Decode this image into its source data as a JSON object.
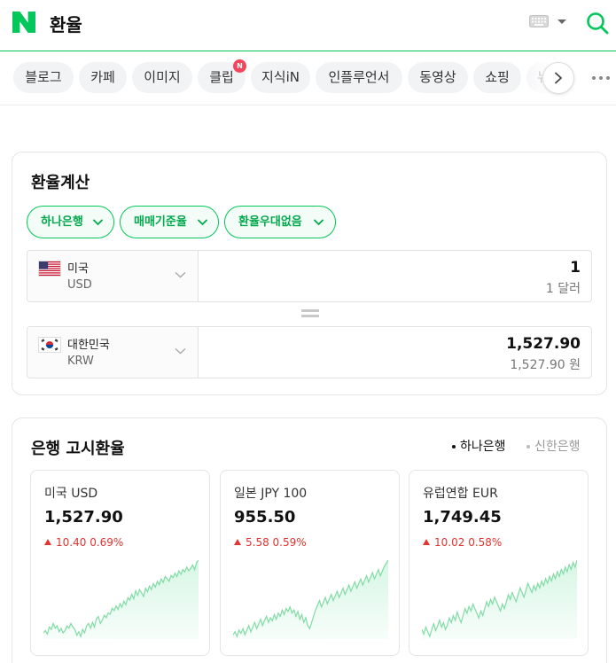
{
  "header": {
    "query": "환율",
    "brand_color": "#03c75a"
  },
  "tabs": [
    {
      "label": "블로그"
    },
    {
      "label": "카페"
    },
    {
      "label": "이미지"
    },
    {
      "label": "클립",
      "badge": "N"
    },
    {
      "label": "지식iN"
    },
    {
      "label": "인플루언서"
    },
    {
      "label": "동영상"
    },
    {
      "label": "쇼핑"
    },
    {
      "label": "뉴"
    }
  ],
  "icons": {
    "logo": "naver-n-logo",
    "keyboard": "keyboard-icon",
    "search": "search-icon",
    "next": "chevron-right-icon",
    "more": "more-dots-icon"
  },
  "calculator": {
    "title": "환율계산",
    "filters": [
      {
        "label": "하나은행"
      },
      {
        "label": "매매기준율"
      },
      {
        "label": "환율우대없음"
      }
    ],
    "from": {
      "country": "미국",
      "code": "USD",
      "amount": "1",
      "amount_text": "1 달러"
    },
    "to": {
      "country": "대한민국",
      "code": "KRW",
      "amount": "1,527.90",
      "amount_text": "1,527.90 원"
    }
  },
  "bank_rates": {
    "title": "은행 고시환율",
    "banks": [
      {
        "label": "하나은행",
        "selected": true
      },
      {
        "label": "신한은행",
        "selected": false
      }
    ],
    "up_color": "#e3342f",
    "items": [
      {
        "name": "미국 USD",
        "value": "1,527.90",
        "change": "10.40",
        "change_pct": "0.69%",
        "trend": [
          58,
          60,
          57,
          63,
          61,
          66,
          62,
          64,
          59,
          62,
          58,
          60,
          64,
          62,
          66,
          63,
          61,
          56,
          59,
          55,
          61,
          58,
          64,
          66,
          62,
          67,
          63,
          70,
          72,
          66,
          69,
          73,
          71,
          75,
          74,
          79,
          77,
          81,
          78,
          83,
          80,
          85,
          82,
          88,
          86,
          91,
          87,
          94,
          90,
          95,
          92,
          89,
          96,
          93,
          98,
          95,
          100,
          97,
          102,
          99,
          104,
          101,
          106,
          104,
          102,
          107,
          105,
          109,
          106,
          111,
          108,
          112,
          110,
          114,
          111,
          113,
          116,
          112,
          118,
          120
        ]
      },
      {
        "name": "일본 JPY 100",
        "value": "955.50",
        "change": "5.58",
        "change_pct": "0.59%",
        "trend": [
          64,
          66,
          63,
          67,
          65,
          68,
          64,
          67,
          70,
          66,
          69,
          72,
          68,
          71,
          74,
          70,
          73,
          76,
          72,
          75,
          73,
          77,
          74,
          78,
          76,
          80,
          77,
          81,
          79,
          82,
          78,
          80,
          76,
          79,
          74,
          77,
          72,
          75,
          70,
          68,
          72,
          76,
          80,
          83,
          86,
          82,
          85,
          88,
          84,
          87,
          90,
          86,
          89,
          92,
          88,
          91,
          94,
          90,
          93,
          96,
          92,
          95,
          98,
          94,
          97,
          100,
          96,
          99,
          102,
          98,
          101,
          104,
          100,
          103,
          106,
          102,
          105,
          108,
          110,
          112
        ]
      },
      {
        "name": "유럽연합 EUR",
        "value": "1,749.45",
        "change": "10.02",
        "change_pct": "0.58%",
        "trend": [
          70,
          66,
          72,
          68,
          64,
          70,
          75,
          69,
          73,
          78,
          72,
          76,
          70,
          74,
          80,
          76,
          82,
          78,
          85,
          80,
          76,
          82,
          88,
          84,
          90,
          86,
          92,
          88,
          84,
          80,
          86,
          82,
          88,
          94,
          90,
          96,
          92,
          98,
          94,
          90,
          86,
          92,
          88,
          94,
          100,
          96,
          102,
          98,
          94,
          100,
          106,
          102,
          98,
          104,
          110,
          106,
          102,
          108,
          104,
          110,
          106,
          112,
          108,
          114,
          110,
          116,
          112,
          118,
          114,
          120,
          116,
          122,
          118,
          124,
          120,
          126,
          122,
          128,
          124,
          130
        ]
      }
    ]
  }
}
